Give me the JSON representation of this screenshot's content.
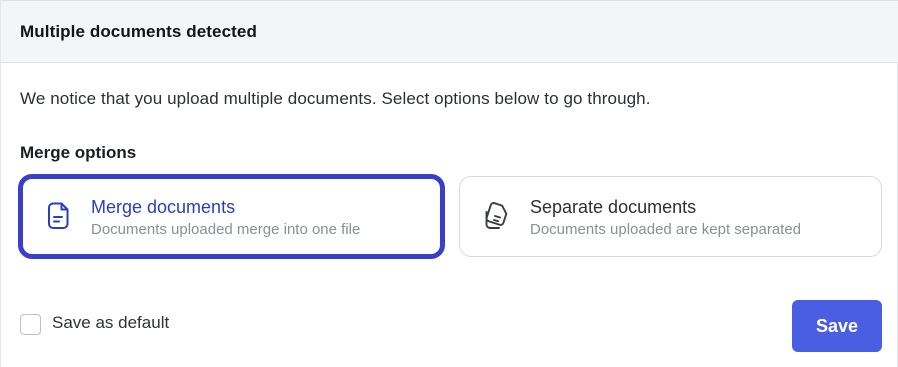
{
  "dialog": {
    "title": "Multiple documents detected",
    "notice": "We notice that you upload multiple documents. Select options below to go through.",
    "section_title": "Merge options",
    "options": [
      {
        "title": "Merge documents",
        "description": "Documents uploaded merge into one file",
        "icon": "merge-document-icon",
        "selected": true
      },
      {
        "title": "Separate documents",
        "description": "Documents uploaded are kept separated",
        "icon": "separate-documents-icon",
        "selected": false
      }
    ],
    "save_default_label": "Save as default",
    "save_default_checked": false,
    "save_button": "Save"
  },
  "colors": {
    "accent": "#4a5ee4",
    "selected_outline": "#3a3fcb",
    "selected_title": "#2a3ec2",
    "header_bg": "#f3f5f8"
  }
}
